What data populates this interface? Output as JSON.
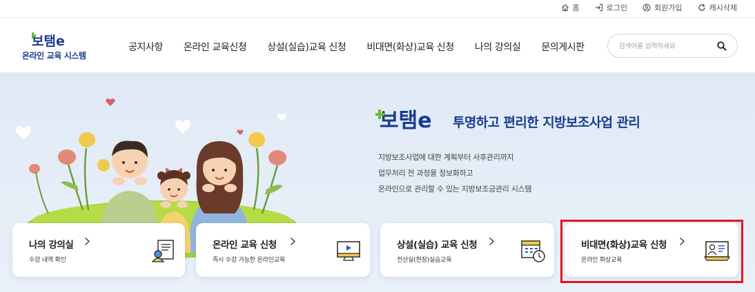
{
  "util_bar": {
    "items": [
      {
        "label": "홈",
        "icon": "home-icon"
      },
      {
        "label": "로그인",
        "icon": "login-icon"
      },
      {
        "label": "회원가입",
        "icon": "user-circle-icon"
      },
      {
        "label": "캐시삭제",
        "icon": "refresh-icon"
      }
    ]
  },
  "header": {
    "logo_text": "보탬e",
    "logo_sub": "온라인 교육 시스템",
    "nav": [
      "공지사항",
      "온라인 교육신청",
      "상설(실습)교육 신청",
      "비대면(화상)교육 신청",
      "나의 강의실",
      "문의게시판"
    ],
    "search_placeholder": "검색어를 입력하세요"
  },
  "hero": {
    "tagline": "투명하고 편리한 지방보조사업 관리",
    "desc": [
      "지방보조사업에 대한 계획부터 사후관리까지",
      "업무처리 전 과정을 정보화하고",
      "온라인으로 관리할 수 있는 지방보조금관리 시스템"
    ]
  },
  "cards": [
    {
      "title": "나의 강의실",
      "sub": "수강 내역 확인",
      "icon": "certificate-icon"
    },
    {
      "title": "온라인 교육 신청",
      "sub": "즉시 수강 가능한 온라인교육",
      "icon": "video-monitor-icon"
    },
    {
      "title": "상설(실습) 교육 신청",
      "sub": "전산실(현장)실습교육",
      "icon": "calendar-clock-icon"
    },
    {
      "title": "비대면(화상)교육 신청",
      "sub": "온라인 화상교육",
      "icon": "video-conference-icon"
    }
  ],
  "colors": {
    "brand_navy": "#1a3b8f",
    "brand_green": "#6cbf2b",
    "hero_bg": "#e3ecf7",
    "highlight": "#e3161e"
  }
}
